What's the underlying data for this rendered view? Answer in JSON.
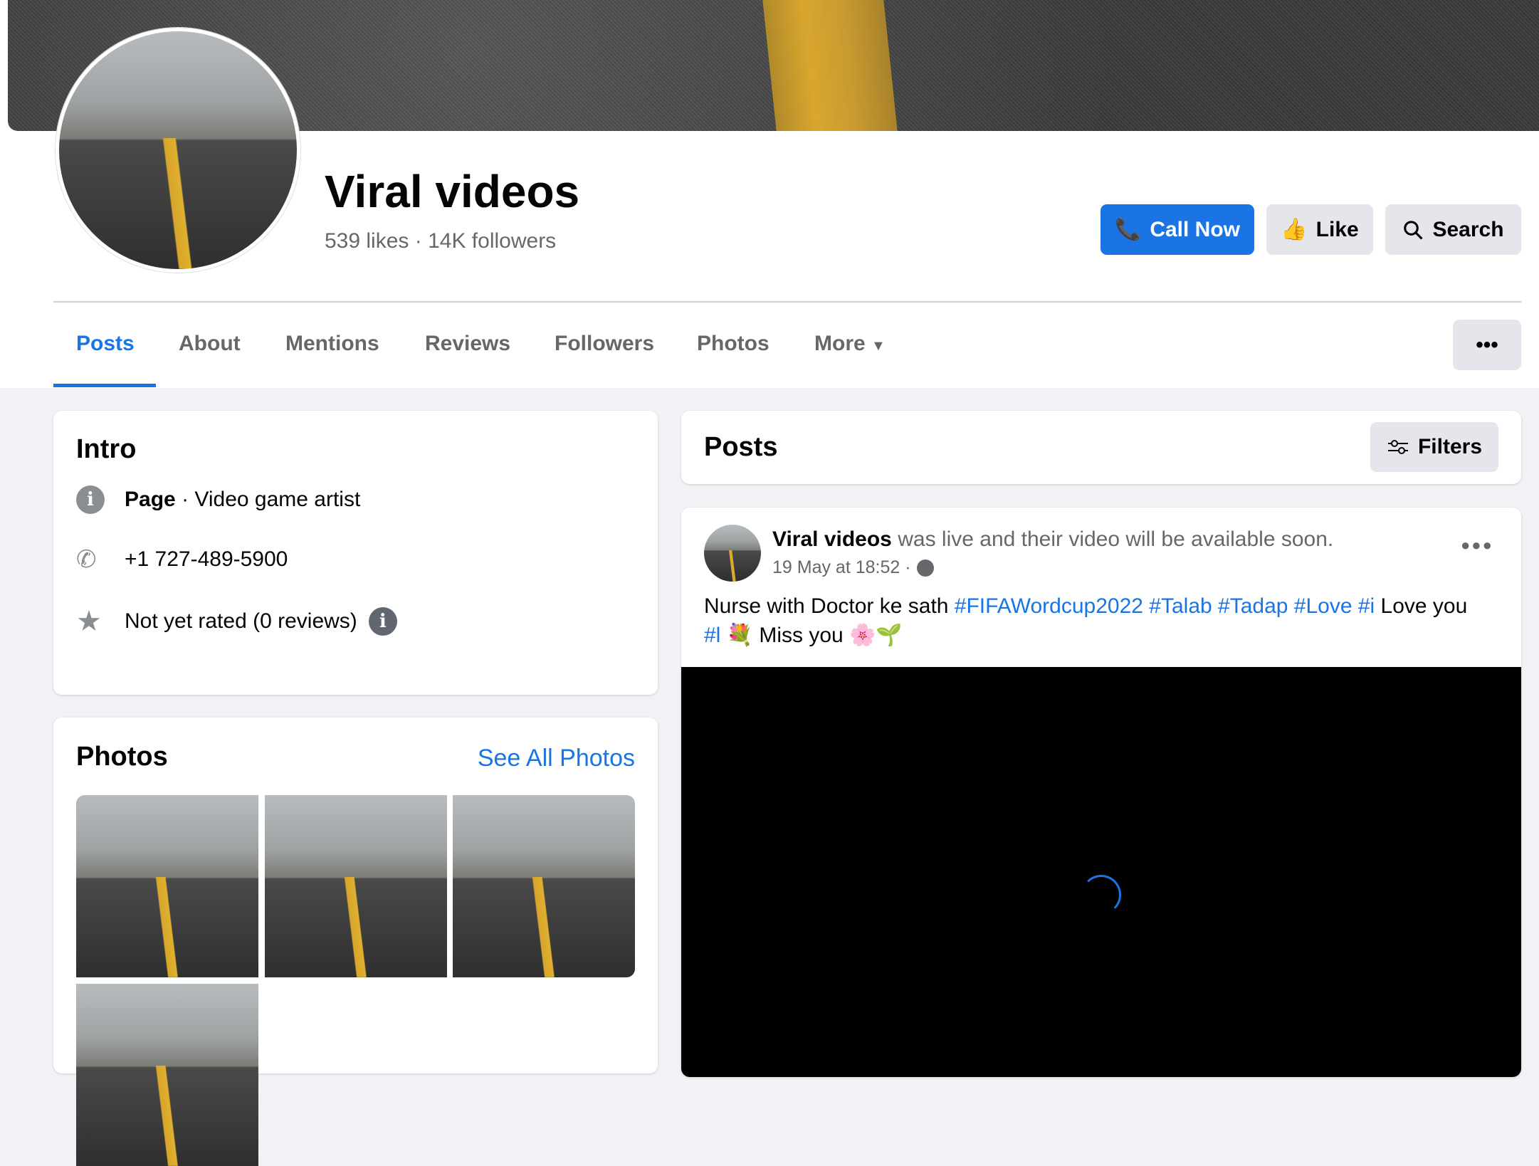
{
  "page": {
    "name": "Viral videos",
    "likes": "539 likes",
    "followers": "14K followers",
    "separator": "·"
  },
  "actions": {
    "call": "Call Now",
    "like": "Like",
    "search": "Search"
  },
  "tabs": [
    "Posts",
    "About",
    "Mentions",
    "Reviews",
    "Followers",
    "Photos",
    "More"
  ],
  "intro": {
    "title": "Intro",
    "category_label": "Page",
    "category": "· Video game artist",
    "phone": "+1 727-489-5900",
    "rating": "Not yet rated (0 reviews)"
  },
  "photos": {
    "title": "Photos",
    "see_all": "See All Photos"
  },
  "posts": {
    "title": "Posts",
    "filters": "Filters"
  },
  "post": {
    "author": "Viral videos",
    "action": "was live and their video will be available soon.",
    "time": "19 May at 18:52 ·",
    "text_start": "Nurse with Doctor ke sath ",
    "hashtags": "#FIFAWordcup2022 #Talab #Tadap #Love #i",
    "text_mid": " Love  you",
    "hashtag2": "#l",
    "text_end": " 💐 Miss you 🌸🌱"
  },
  "colors": {
    "accent": "#1b74e4",
    "background": "#f0f2f5"
  }
}
